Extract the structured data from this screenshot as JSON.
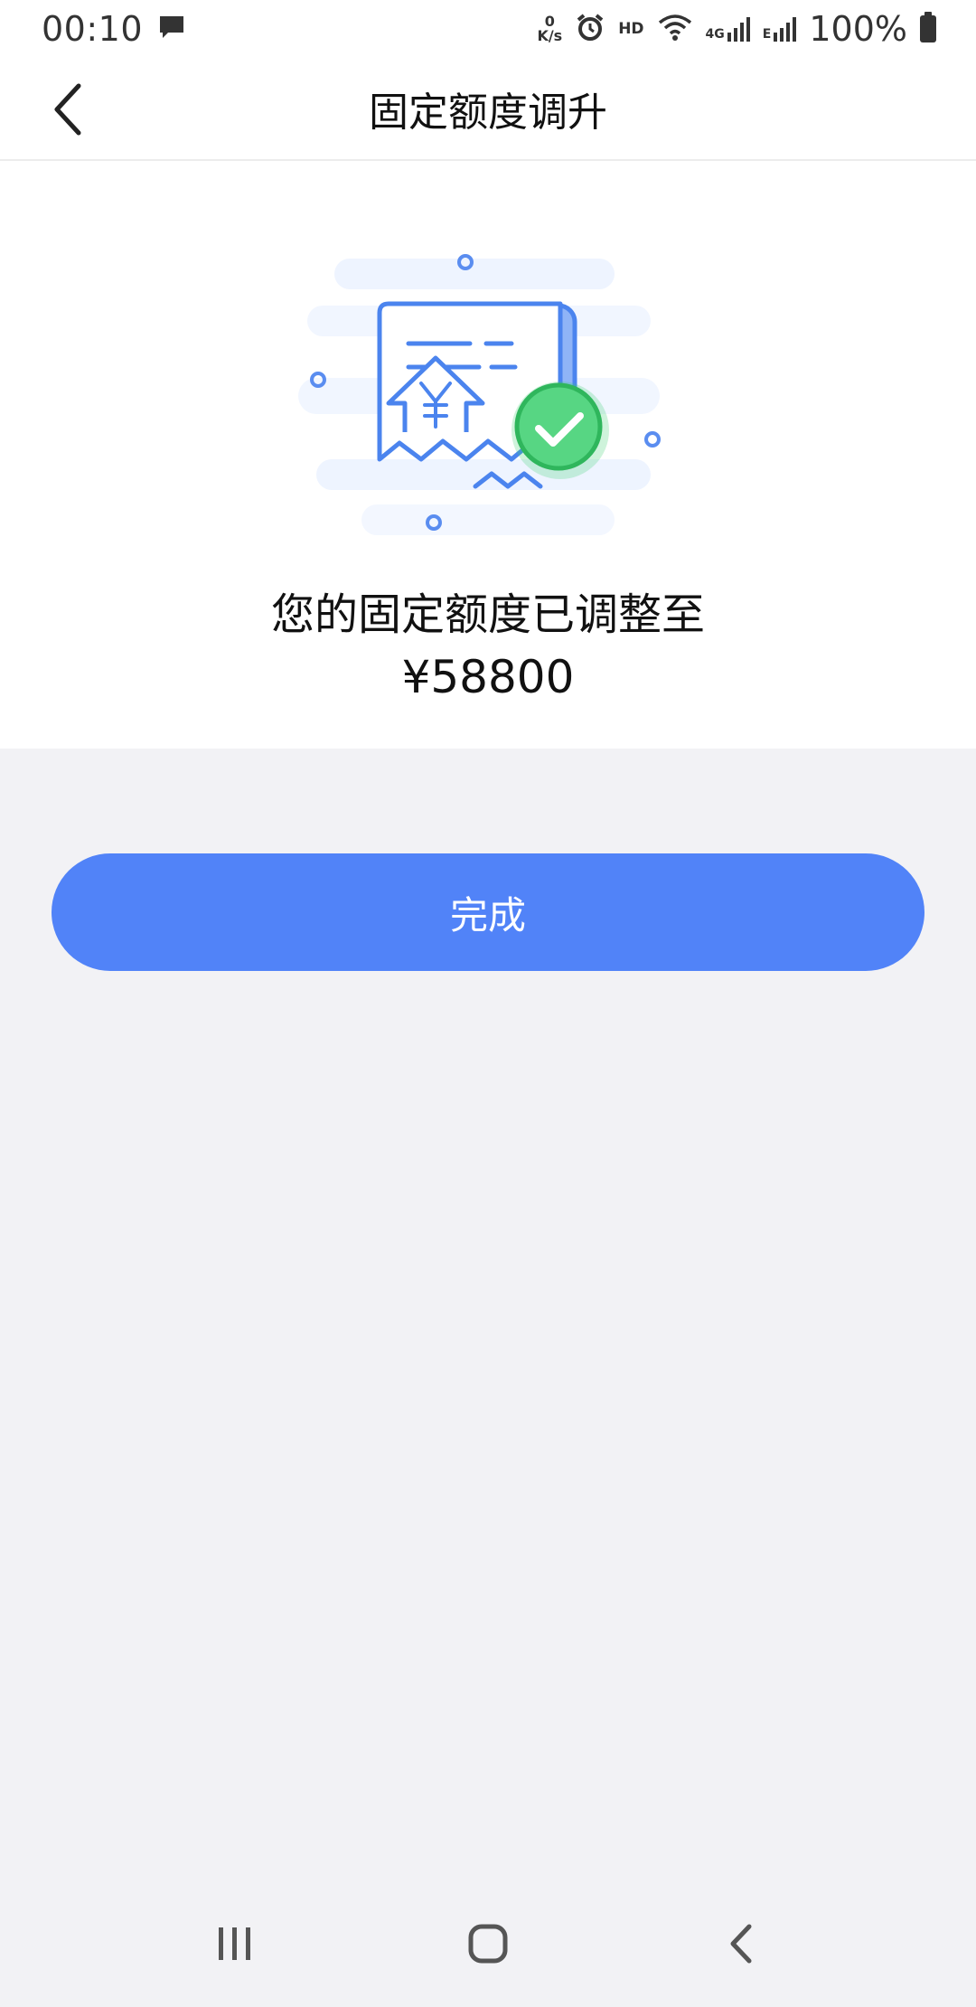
{
  "status_bar": {
    "time": "00:10",
    "net_speed_value": "0",
    "net_speed_unit": "K/s",
    "hd_label": "HD",
    "net_4g": "4G",
    "net_e": "E",
    "battery": "100%"
  },
  "header": {
    "title": "固定额度调升"
  },
  "result": {
    "message": "您的固定额度已调整至",
    "amount": "¥58800"
  },
  "actions": {
    "done_label": "完成"
  },
  "colors": {
    "primary": "#5183f8",
    "success": "#3ccf6e",
    "background": "#f2f2f5"
  },
  "icons": {
    "back": "chevron-left-icon",
    "illustration": "receipt-success-icon",
    "nav_recent": "recent-apps-icon",
    "nav_home": "home-icon",
    "nav_back": "back-icon"
  }
}
